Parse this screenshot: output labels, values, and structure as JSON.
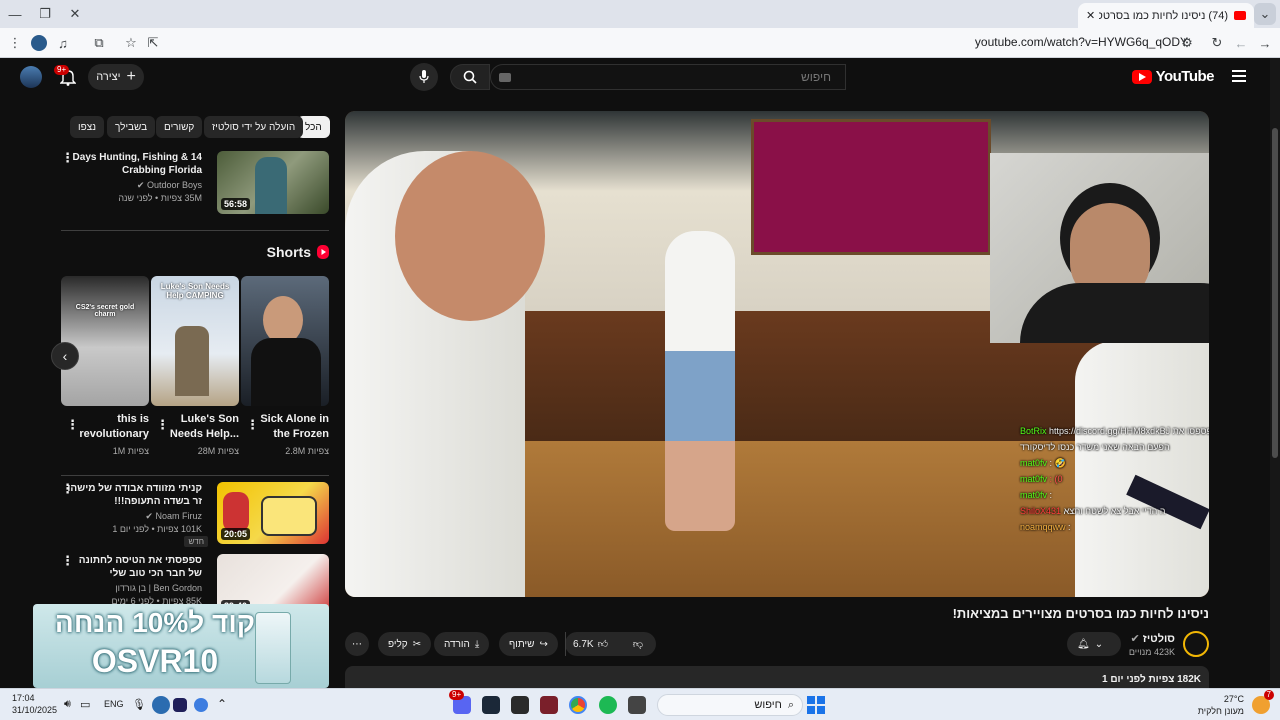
{
  "browser": {
    "tab_title": "(74) ניסינו לחיות כמו בסרטס",
    "tab_close": "✕",
    "new_tab": "+",
    "url": "youtube.com/watch?v=HYWG6q_qODY"
  },
  "header": {
    "logo_text": "YouTube",
    "search_placeholder": "חיפוש",
    "create_label": "יצירה",
    "notifications_badge": "9+"
  },
  "chips": [
    "הכל",
    "הועלה על ידי סולטיז",
    "קשורים",
    "בשבילך",
    "נצפו"
  ],
  "top_video": {
    "title": "14 Days Hunting, Fishing & Crabbing Florida",
    "channel": "Outdoor Boys",
    "meta": "35M צפיות • לפני שנה",
    "duration": "56:58"
  },
  "shorts": {
    "heading": "Shorts",
    "items": [
      {
        "title": "Sick Alone in the Frozen",
        "views": "2.8M צפיות"
      },
      {
        "title": "Luke's Son Needs Help...",
        "views": "28M צפיות",
        "overlay": "Luke's Son Needs Help CAMPING"
      },
      {
        "title": "this is revolutionary",
        "views": "1M צפיות",
        "overlay": "CS2's secret gold charm"
      }
    ]
  },
  "related": [
    {
      "title": "קניתי מזוודה אבודה של מישהו זר בשדה התעופה!!!",
      "channel": "Noam Firuz",
      "meta": "101K צפיות • לפני יום 1",
      "badge": "חדש",
      "duration": "20:05"
    },
    {
      "title": "ספפסתי את הטיסה לחתונה של חבר הכי טוב שלי",
      "channel": "Ben Gordon | בן גורדון",
      "meta": "85K צפיות • לפני 6 ימים",
      "duration": "39:40"
    }
  ],
  "ad": {
    "headline": "קוד ל10% הנחה",
    "code": "OSVR10"
  },
  "chat": {
    "lines": [
      {
        "user": "BotRix",
        "text": "https://discord.gg/HHM8xdkBJ ל שתפספסו את"
      },
      {
        "user": "",
        "text": "הפעם הבאה שאני משדר כנסו לדיסקורד"
      },
      {
        "user": "mat0fv",
        "text": ": 🤣"
      },
      {
        "user": "mat0fv",
        "text": ": (0"
      },
      {
        "user": "mat0fv",
        "text": ":"
      },
      {
        "user": "ShiloX431",
        "text": "ה הדיי אבל צא לשטח ותצא"
      },
      {
        "user": "noamqqww",
        "text": ":"
      }
    ]
  },
  "video": {
    "title": "ניסינו לחיות כמו בסרטים מצויירים במציאות!",
    "channel": "סולטיז",
    "subscribers": "423K מנויים",
    "likes": "6.7K",
    "share_label": "שיתוף",
    "download_label": "הורדה",
    "clip_label": "קליפ",
    "views_line": "182K צפיות  לפני יום 1"
  },
  "taskbar": {
    "time": "17:04",
    "date": "31/10/2025",
    "lang": "ENG",
    "search_label": "חיפוש",
    "weather_temp": "27°C",
    "weather_desc": "מעונן חלקית",
    "weather_badge": "7",
    "discord_badge": "9+"
  }
}
